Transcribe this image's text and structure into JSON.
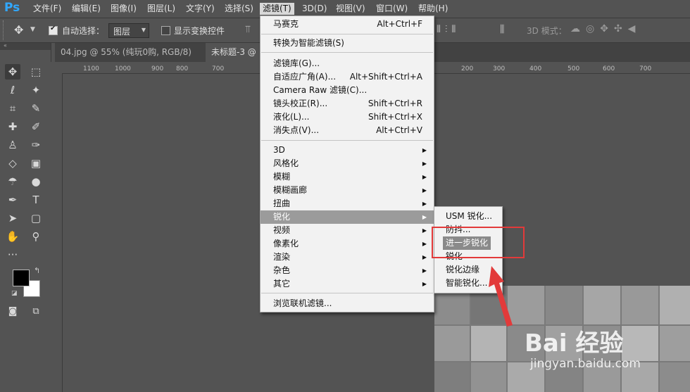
{
  "app": {
    "logo": "Ps"
  },
  "menubar": [
    {
      "label": "文件(F)"
    },
    {
      "label": "编辑(E)"
    },
    {
      "label": "图像(I)"
    },
    {
      "label": "图层(L)"
    },
    {
      "label": "文字(Y)"
    },
    {
      "label": "选择(S)"
    },
    {
      "label": "滤镜(T)"
    },
    {
      "label": "3D(D)"
    },
    {
      "label": "视图(V)"
    },
    {
      "label": "窗口(W)"
    },
    {
      "label": "帮助(H)"
    }
  ],
  "options": {
    "auto_select_label": "自动选择：",
    "auto_select_value": "图层",
    "show_transform_label": "显示变换控件",
    "mode_label": "3D 模式："
  },
  "tabs": [
    {
      "label": "04.jpg @ 55% (纯玩0购, RGB/8) *",
      "close": "×"
    },
    {
      "label": "未标题-3 @"
    }
  ],
  "ruler": {
    "ticks": [
      "1100",
      "1000",
      "900",
      "800",
      "700",
      "200",
      "300",
      "400",
      "500",
      "600",
      "700"
    ]
  },
  "filter_menu": {
    "items": [
      {
        "label": "马赛克",
        "shortcut": "Alt+Ctrl+F"
      },
      {
        "label": "转换为智能滤镜(S)"
      },
      {
        "label": "滤镜库(G)..."
      },
      {
        "label": "自适应广角(A)...",
        "shortcut": "Alt+Shift+Ctrl+A"
      },
      {
        "label": "Camera Raw 滤镜(C)...",
        "shortcut": ""
      },
      {
        "label": "镜头校正(R)...",
        "shortcut": "Shift+Ctrl+R"
      },
      {
        "label": "液化(L)...",
        "shortcut": "Shift+Ctrl+X"
      },
      {
        "label": "消失点(V)...",
        "shortcut": "Alt+Ctrl+V"
      },
      {
        "label": "3D"
      },
      {
        "label": "风格化"
      },
      {
        "label": "模糊"
      },
      {
        "label": "模糊画廊"
      },
      {
        "label": "扭曲"
      },
      {
        "label": "锐化"
      },
      {
        "label": "视频"
      },
      {
        "label": "像素化"
      },
      {
        "label": "渲染"
      },
      {
        "label": "杂色"
      },
      {
        "label": "其它"
      },
      {
        "label": "浏览联机滤镜..."
      }
    ]
  },
  "sharpen_submenu": {
    "items": [
      {
        "label": "USM 锐化..."
      },
      {
        "label": "防抖..."
      },
      {
        "label": "进一步锐化"
      },
      {
        "label": "锐化"
      },
      {
        "label": "锐化边缘"
      },
      {
        "label": "智能锐化..."
      }
    ]
  },
  "watermark": {
    "text": "Bai 经验",
    "url": "jingyan.baidu.com"
  }
}
